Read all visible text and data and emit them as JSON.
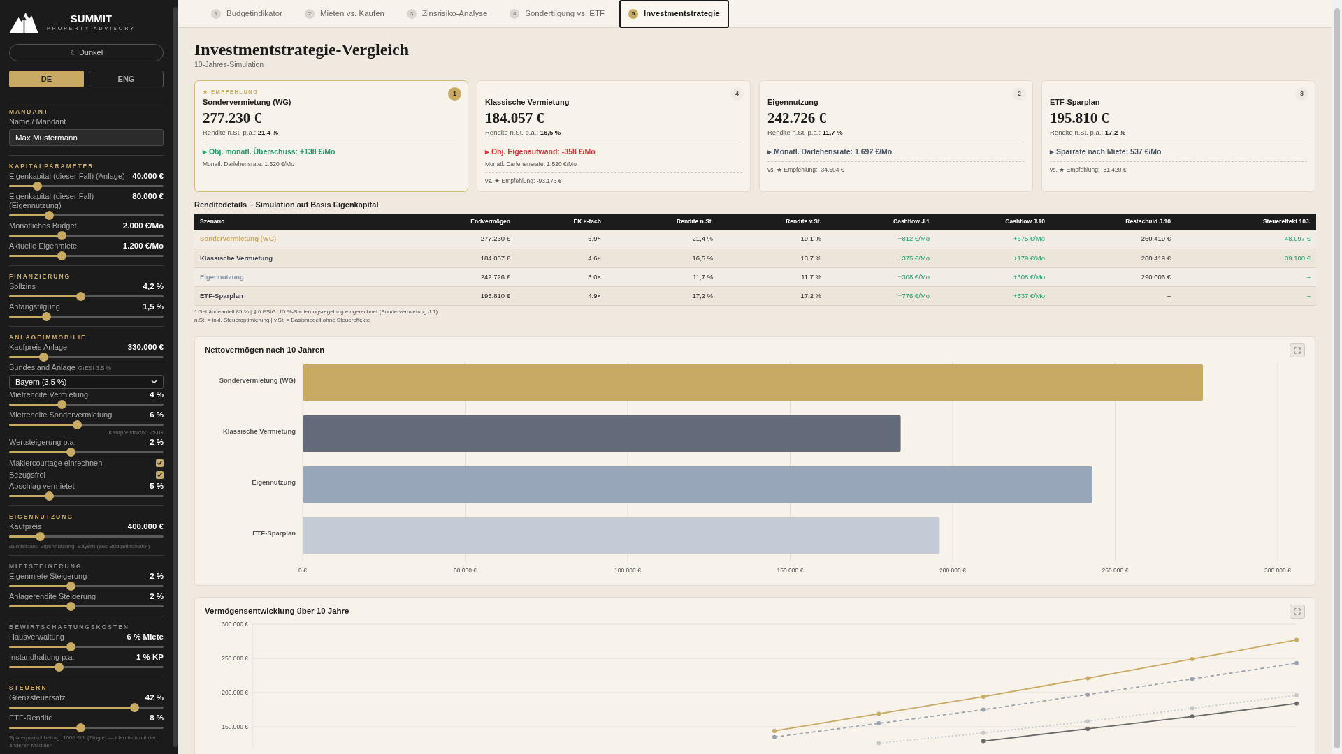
{
  "brand": {
    "name": "SUMMIT",
    "tagline": "PROPERTY ADVISORY"
  },
  "theme_button": {
    "label": "☾ Dunkel"
  },
  "languages": [
    {
      "label": "DE",
      "selected": true
    },
    {
      "label": "ENG",
      "selected": false
    }
  ],
  "sidebar": {
    "sections": [
      {
        "title": "MANDANT",
        "color": "#c8aa63",
        "items": [
          {
            "kind": "input",
            "label": "Name / Mandant",
            "value": "Max Mustermann"
          }
        ]
      },
      {
        "title": "KAPITALPARAMETER",
        "color": "#c8aa63",
        "items": [
          {
            "kind": "slider",
            "label": "Eigenkapital (dieser Fall) (Anlage)",
            "value": "40.000 €",
            "level": 0.18
          },
          {
            "kind": "slider",
            "label": "Eigenkapital (dieser Fall) (Eigennutzung)",
            "value": "80.000 €",
            "level": 0.26
          },
          {
            "kind": "slider",
            "label": "Monatliches Budget",
            "value": "2.000 €/Mo",
            "level": 0.34
          },
          {
            "kind": "slider",
            "label": "Aktuelle Eigenmiete",
            "value": "1.200 €/Mo",
            "level": 0.34
          }
        ]
      },
      {
        "title": "FINANZIERUNG",
        "color": "#c8aa63",
        "items": [
          {
            "kind": "slider",
            "label": "Sollzins",
            "value": "4,2 %",
            "level": 0.46
          },
          {
            "kind": "slider",
            "label": "Anfangstilgung",
            "value": "1,5 %",
            "level": 0.24
          }
        ]
      },
      {
        "title": "ANLAGEIMMOBILIE",
        "color": "#c8aa63",
        "items": [
          {
            "kind": "slider",
            "label": "Kaufpreis Anlage",
            "value": "330.000 €",
            "level": 0.22
          },
          {
            "kind": "select",
            "label": "Bundesland Anlage",
            "hint": "GrESt 3.5 %",
            "value": "Bayern (3.5 %)"
          },
          {
            "kind": "slider",
            "label": "Mietrendite Vermietung",
            "value": "4 %",
            "level": 0.34
          },
          {
            "kind": "slider",
            "label": "Mietrendite Sondervermietung",
            "value": "6 %",
            "level": 0.44,
            "note": "Kaufpreisfaktor: 25.0×"
          },
          {
            "kind": "slider",
            "label": "Wertsteigerung p.a.",
            "value": "2 %",
            "level": 0.4
          },
          {
            "kind": "checkbox",
            "label": "Maklercourtage einrechnen",
            "checked": true
          },
          {
            "kind": "checkbox",
            "label": "Bezugsfrei",
            "checked": true
          },
          {
            "kind": "slider",
            "label": "Abschlag vermietet",
            "value": "5 %",
            "level": 0.26
          }
        ]
      },
      {
        "title": "EIGENNUTZUNG",
        "color": "#c8aa63",
        "items": [
          {
            "kind": "slider",
            "label": "Kaufpreis",
            "value": "400.000 €",
            "level": 0.2
          },
          {
            "kind": "note",
            "text": "Bundesland Eigennutzung: Bayern (aus Budgetindikator)"
          }
        ]
      },
      {
        "title": "MIETSTEIGERUNG",
        "color": "#8a8a8a",
        "items": [
          {
            "kind": "slider",
            "label": "Eigenmiete Steigerung",
            "value": "2 %",
            "level": 0.4
          },
          {
            "kind": "slider",
            "label": "Anlagerendite Steigerung",
            "value": "2 %",
            "level": 0.4
          }
        ]
      },
      {
        "title": "BEWIRTSCHAFTUNGSKOSTEN",
        "color": "#8a8a8a",
        "items": [
          {
            "kind": "slider",
            "label": "Hausverwaltung",
            "value": "6 % Miete",
            "level": 0.4
          },
          {
            "kind": "slider",
            "label": "Instandhaltung p.a.",
            "value": "1 % KP",
            "level": 0.32
          }
        ]
      },
      {
        "title": "STEUERN",
        "color": "#c8aa63",
        "items": [
          {
            "kind": "slider",
            "label": "Grenzsteuersatz",
            "value": "42 %",
            "level": 0.81
          },
          {
            "kind": "slider",
            "label": "ETF-Rendite",
            "value": "8 %",
            "level": 0.46
          },
          {
            "kind": "note",
            "text": "Sparerpauschbetrag: 1000 €/J. (Single) — identisch mit den anderen Modulen"
          }
        ]
      }
    ]
  },
  "tabs": [
    {
      "number": "1",
      "label": "Budgetindikator",
      "selected": false
    },
    {
      "number": "2",
      "label": "Mieten vs. Kaufen",
      "selected": false
    },
    {
      "number": "3",
      "label": "Zinsrisiko-Analyse",
      "selected": false
    },
    {
      "number": "4",
      "label": "Sondertilgung vs. ETF",
      "selected": false
    },
    {
      "number": "5",
      "label": "Investmentstrategie",
      "selected": true
    }
  ],
  "page": {
    "title": "Investmentstrategie-Vergleich",
    "subtitle": "10-Jahres-Simulation"
  },
  "cards": [
    {
      "recommended": true,
      "badge_text": "★ EMPFEHLUNG",
      "rank": "1",
      "name": "Sondervermietung (WG)",
      "amount": "277.230 €",
      "rendite_label": "Rendite n.St. p.a.:",
      "rendite": "21,4 %",
      "highlight": "▸ Obj. monatl. Überschuss: +138 €/Mo",
      "color": "#1f9d6b",
      "note": "Monatl. Darlehensrate: 1.520 €/Mo"
    },
    {
      "recommended": false,
      "rank": "4",
      "name": "Klassische Vermietung",
      "amount": "184.057 €",
      "rendite_label": "Rendite n.St. p.a.:",
      "rendite": "16,5 %",
      "highlight": "▸ Obj. Eigenaufwand: -358 €/Mo",
      "color": "#d23a3a",
      "note": "Monatl. Darlehensrate: 1.520 €/Mo",
      "comparison": "vs. ★ Empfehlung: -93.173 €"
    },
    {
      "recommended": false,
      "rank": "2",
      "name": "Eigennutzung",
      "amount": "242.726 €",
      "rendite_label": "Rendite n.St. p.a.:",
      "rendite": "11,7 %",
      "highlight": "▸ Monatl. Darlehensrate: 1.692 €/Mo",
      "color": "#4b5568",
      "comparison": "vs. ★ Empfehlung: -34.504 €"
    },
    {
      "recommended": false,
      "rank": "3",
      "name": "ETF-Sparplan",
      "amount": "195.810 €",
      "rendite_label": "Rendite n.St. p.a.:",
      "rendite": "17,2 %",
      "highlight": "▸ Sparrate nach Miete: 537 €/Mo",
      "color": "#4b5568",
      "comparison": "vs. ★ Empfehlung: -81.420 €"
    }
  ],
  "table": {
    "title": "Renditedetails – Simulation auf Basis Eigenkapital",
    "columns": [
      {
        "label": "Szenario",
        "kind": "name"
      },
      {
        "label": "Endvermögen",
        "kind": "plain"
      },
      {
        "label": "EK ×-fach",
        "kind": "plain"
      },
      {
        "label": "Rendite n.St.",
        "kind": "plain"
      },
      {
        "label": "Rendite v.St.",
        "kind": "plain"
      },
      {
        "label": "Cashflow J.1",
        "kind": "gain"
      },
      {
        "label": "Cashflow J.10",
        "kind": "gain"
      },
      {
        "label": "Restschuld J.10",
        "kind": "plain"
      },
      {
        "label": "Steuereffekt 10J.",
        "kind": "gain"
      }
    ],
    "rows": [
      {
        "color": "#c8aa63",
        "cells": [
          "Sondervermietung (WG)",
          "277.230 €",
          "6.9×",
          "21,4 %",
          "19,1 %",
          "+812 €/Mo",
          "+675 €/Mo",
          "260.419 €",
          "48.097 €"
        ]
      },
      {
        "color": "#3f4450",
        "cells": [
          "Klassische Vermietung",
          "184.057 €",
          "4.6×",
          "16,5 %",
          "13,7 %",
          "+375 €/Mo",
          "+179 €/Mo",
          "260.419 €",
          "39.100 €"
        ]
      },
      {
        "color": "#8e9bb0",
        "cells": [
          "Eigennutzung",
          "242.726 €",
          "3.0×",
          "11,7 %",
          "11,7 %",
          "+308 €/Mo",
          "+308 €/Mo",
          "290.006 €",
          "–"
        ]
      },
      {
        "color": "#3f4450",
        "cells": [
          "ETF-Sparplan",
          "195.810 €",
          "4.9×",
          "17,2 %",
          "17,2 %",
          "+776 €/Mo",
          "+537 €/Mo",
          "–",
          "–"
        ]
      }
    ],
    "footnotes": [
      "* Gebäudeanteil 85 % | § 6 EStG: 15 %-Sanierungsregelung eingerechnet (Sondervermietung J.1)",
      "n.St. = inkl. Steueroptimierung | v.St. = Basismodell ohne Steuereffekte"
    ]
  },
  "bar_chart": {
    "chart_data": {
      "type": "bar",
      "orientation": "horizontal",
      "title": "Nettovermögen nach 10 Jahren",
      "categories": [
        "Sondervermietung (WG)",
        "Klassische Vermietung",
        "Eigennutzung",
        "ETF-Sparplan"
      ],
      "series": [
        {
          "colors": [
            "#c8aa63",
            "#636b7a",
            "#98a6b9",
            "#c3ccd6"
          ],
          "values": [
            277000,
            184000,
            243000,
            196000
          ]
        }
      ],
      "xlim": [
        0,
        300000
      ],
      "grid": true,
      "xticks": [
        {
          "value": 0,
          "label": "0 €"
        },
        {
          "value": 50000,
          "label": "50.000 €"
        },
        {
          "value": 100000,
          "label": "100.000 €"
        },
        {
          "value": 150000,
          "label": "150.000 €"
        },
        {
          "value": 200000,
          "label": "200.000 €"
        },
        {
          "value": 250000,
          "label": "250.000 €"
        },
        {
          "value": 300000,
          "label": "300.000 €"
        }
      ]
    }
  },
  "line_chart": {
    "title": "Vermögensentwicklung über 10 Jahre",
    "axis_labels": [
      "300.000 €",
      "250.000 €",
      "200.000 €",
      "150.000 €"
    ]
  }
}
